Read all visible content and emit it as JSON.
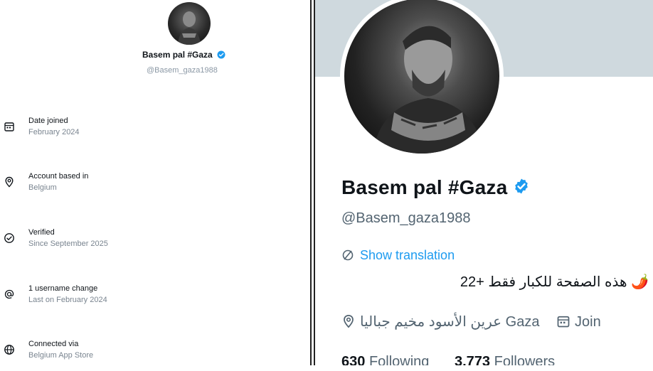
{
  "left_panel": {
    "name": "Basem pal #Gaza",
    "handle": "@Basem_gaza1988",
    "items": [
      {
        "icon": "calendar-icon",
        "title": "Date joined",
        "sub": "February 2024"
      },
      {
        "icon": "location-icon",
        "title": "Account based in",
        "sub": "Belgium"
      },
      {
        "icon": "verified-check-icon",
        "title": "Verified",
        "sub": "Since September 2025"
      },
      {
        "icon": "at-sign-icon",
        "title": "1 username change",
        "sub": "Last on February 2024"
      },
      {
        "icon": "globe-icon",
        "title": "Connected via",
        "sub": "Belgium App Store"
      }
    ]
  },
  "profile": {
    "name": "Basem pal #Gaza",
    "handle": "@Basem_gaza1988",
    "show_translation": "Show translation",
    "bio": "🌶️ هذه الصفحة للكبار فقط +22",
    "location": "عرين الأسود مخيم جباليا Gaza",
    "joined": "Join",
    "following_count": "630",
    "following_label": "Following",
    "followers_count": "3,773",
    "followers_label": "Followers"
  },
  "colors": {
    "verified_blue": "#1d9bf0",
    "banner_gray": "#cfd9de",
    "secondary_text": "#536471"
  }
}
